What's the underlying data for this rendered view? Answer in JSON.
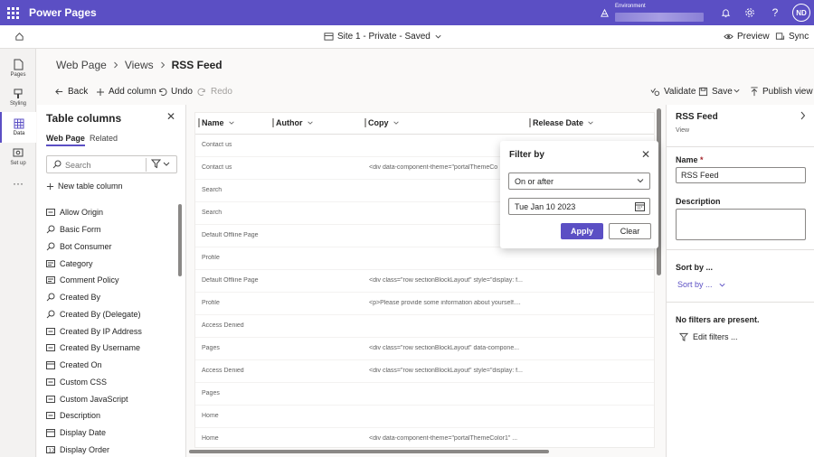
{
  "app": {
    "title": "Power Pages",
    "environment_label": "Environment",
    "avatar_initials": "ND"
  },
  "subbar": {
    "site": "Site 1 - Private - Saved",
    "preview": "Preview",
    "sync": "Sync"
  },
  "rail": {
    "items": [
      {
        "label": "Pages"
      },
      {
        "label": "Styling"
      },
      {
        "label": "Data"
      },
      {
        "label": "Set up"
      }
    ]
  },
  "breadcrumb": {
    "items": [
      "Web Page",
      "Views",
      "RSS Feed"
    ]
  },
  "commands": {
    "back": "Back",
    "add_column": "Add column",
    "undo": "Undo",
    "redo": "Redo",
    "validate": "Validate",
    "save": "Save",
    "publish": "Publish view"
  },
  "colpanel": {
    "title": "Table columns",
    "tabs": [
      "Web Page",
      "Related"
    ],
    "search_placeholder": "Search",
    "new_column": "New table column",
    "columns": [
      {
        "label": "Allow Origin",
        "icon": "text-field-icon"
      },
      {
        "label": "Basic Form",
        "icon": "lookup-icon"
      },
      {
        "label": "Bot Consumer",
        "icon": "lookup-icon"
      },
      {
        "label": "Category",
        "icon": "choice-icon"
      },
      {
        "label": "Comment Policy",
        "icon": "choice-icon"
      },
      {
        "label": "Created By",
        "icon": "lookup-icon"
      },
      {
        "label": "Created By (Delegate)",
        "icon": "lookup-icon"
      },
      {
        "label": "Created By IP Address",
        "icon": "text-field-icon"
      },
      {
        "label": "Created By Username",
        "icon": "text-field-icon"
      },
      {
        "label": "Created On",
        "icon": "calendar-icon"
      },
      {
        "label": "Custom CSS",
        "icon": "text-field-icon"
      },
      {
        "label": "Custom JavaScript",
        "icon": "text-field-icon"
      },
      {
        "label": "Description",
        "icon": "text-field-icon"
      },
      {
        "label": "Display Date",
        "icon": "calendar-icon"
      },
      {
        "label": "Display Order",
        "icon": "number-icon"
      }
    ]
  },
  "grid": {
    "headers": [
      "Name",
      "Author",
      "Copy",
      "Release Date"
    ],
    "rows": [
      {
        "name": "Contact us",
        "copy": ""
      },
      {
        "name": "Contact us",
        "copy": "<div data-component-theme=\"portalThemeCo"
      },
      {
        "name": "Search",
        "copy": ""
      },
      {
        "name": "Search",
        "copy": ""
      },
      {
        "name": "Default Offline Page",
        "copy": ""
      },
      {
        "name": "Profile",
        "copy": ""
      },
      {
        "name": "Default Offline Page",
        "copy": "<div class=\"row sectionBlockLayout\" style=\"display: f..."
      },
      {
        "name": "Profile",
        "copy": "<p>Please provide some information about yourself...."
      },
      {
        "name": "Access Denied",
        "copy": ""
      },
      {
        "name": "Pages",
        "copy": "<div class=\"row sectionBlockLayout\" data-compone..."
      },
      {
        "name": "Access Denied",
        "copy": "<div class=\"row sectionBlockLayout\" style=\"display: f..."
      },
      {
        "name": "Pages",
        "copy": ""
      },
      {
        "name": "Home",
        "copy": ""
      },
      {
        "name": "Home",
        "copy": "<div data-component-theme=\"portalThemeColor1\" ..."
      }
    ]
  },
  "filter": {
    "title": "Filter by",
    "operator": "On or after",
    "date": "Tue Jan 10 2023",
    "apply": "Apply",
    "clear": "Clear"
  },
  "props": {
    "title": "RSS Feed",
    "subtitle": "View",
    "name_label": "Name",
    "name_required": "*",
    "name_value": "RSS Feed",
    "description_label": "Description",
    "sort_label": "Sort by ...",
    "sort_dropdown": "Sort by ...",
    "no_filters": "No filters are present.",
    "edit_filters": "Edit filters ..."
  },
  "colors": {
    "accent": "#5b4fc4"
  }
}
